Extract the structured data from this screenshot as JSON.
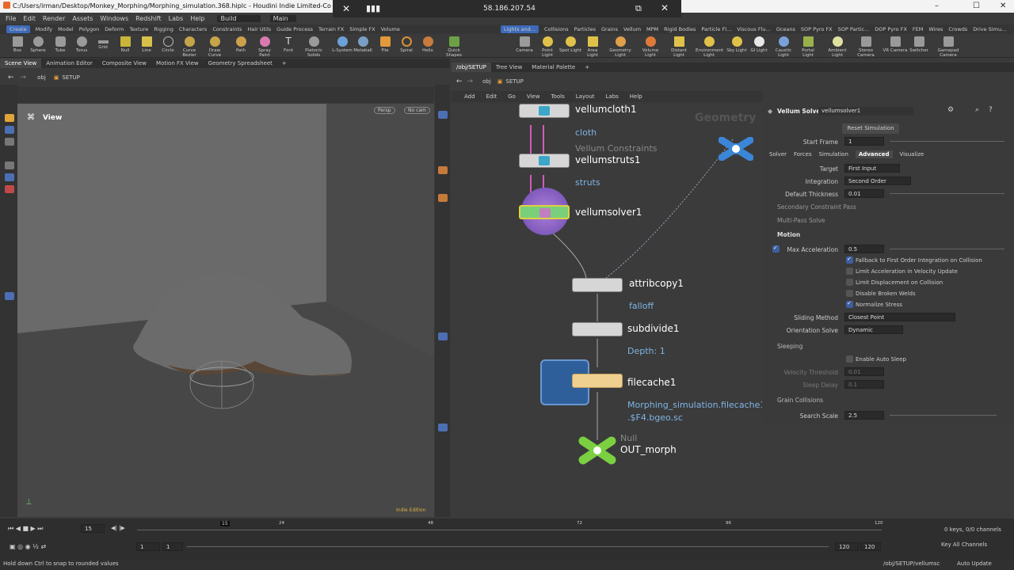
{
  "titlebar": {
    "path": "C:/Users/irman/Desktop/Monkey_Morphing/Morphing_simulation.368.hiplc - Houdini Indie Limited-Commercial 2"
  },
  "remote": {
    "ip": "58.186.207.54"
  },
  "menubar": {
    "items": [
      "File",
      "Edit",
      "Render",
      "Assets",
      "Windows",
      "Redshift",
      "Labs",
      "Help"
    ],
    "desktop": "Build",
    "main": "Main"
  },
  "shelf_tabs_left": [
    "Create",
    "Modify",
    "Model",
    "Polygon",
    "Deform",
    "Texture",
    "Rigging",
    "Characters",
    "Constraints",
    "Hair Utils",
    "Guide Process",
    "Terrain FX",
    "Simple FX",
    "Volume"
  ],
  "shelf_tabs_right": [
    "Lights and...",
    "Collisions",
    "Particles",
    "Grains",
    "Vellum",
    "MPM",
    "Rigid Bodies",
    "Particle Fl...",
    "Viscous Flu...",
    "Oceans",
    "SOP Pyro FX",
    "SOP Partic...",
    "DOP Pyro FX",
    "FEM",
    "Wires",
    "Crowds",
    "Drive Simu..."
  ],
  "tools_left": [
    "Box",
    "Sphere",
    "Tube",
    "Torus",
    "Grid",
    "Null",
    "Line",
    "Circle",
    "Curve Bezier",
    "Draw Curve",
    "Path",
    "Spray Paint",
    "Font",
    "Platonic Solids",
    "L-System",
    "Metaball",
    "File",
    "Spiral",
    "Helix",
    "Quick Shapes"
  ],
  "tools_right": [
    "Camera",
    "Point Light",
    "Spot Light",
    "Area Light",
    "Geometry Light",
    "Volume Light",
    "Distant Light",
    "Environment Light",
    "Sky Light",
    "GI Light",
    "Caustic Light",
    "Portal Light",
    "Ambient Light",
    "Stereo Camera",
    "VR Camera",
    "Switcher",
    "Gamepad Camera"
  ],
  "left_tabs": [
    "Scene View",
    "Animation Editor",
    "Composite View",
    "Motion FX View",
    "Geometry Spreadsheet"
  ],
  "right_tabs": [
    "/obj/SETUP",
    "Tree View",
    "Material Palette"
  ],
  "path": {
    "obj": "obj",
    "setup": "SETUP"
  },
  "viewport": {
    "label": "View",
    "persp": "Persp",
    "cam": "No cam",
    "edition": "Indie Edition"
  },
  "network_menu": [
    "Add",
    "Edit",
    "Go",
    "View",
    "Tools",
    "Layout",
    "Labs",
    "Help"
  ],
  "network": {
    "watermark": "Geometry",
    "nodes": [
      {
        "name": "vellumcloth1",
        "sub": "cloth",
        "type": ""
      },
      {
        "name": "vellumstruts1",
        "sub": "struts",
        "type": "Vellum Constraints"
      },
      {
        "name": "vellumsolver1",
        "sub": "",
        "type": ""
      },
      {
        "name": "attribcopy1",
        "sub": "falloff",
        "type": ""
      },
      {
        "name": "subdivide1",
        "sub": "Depth: 1",
        "type": ""
      },
      {
        "name": "filecache1",
        "sub": "Morphing_simulation.filecache1",
        "sub2": ".$F4.bgeo.sc",
        "type": ""
      },
      {
        "name": "OUT_morph",
        "sub": "",
        "type": "Null"
      }
    ]
  },
  "params": {
    "title": "Vellum Solver",
    "node": "vellumsolver1",
    "reset": "Reset Simulation",
    "start_frame_label": "Start Frame",
    "start_frame": "1",
    "tabs": [
      "Solver",
      "Forces",
      "Simulation",
      "Advanced",
      "Visualize"
    ],
    "target_label": "Target",
    "target": "First Input",
    "integration_label": "Integration",
    "integration": "Second Order",
    "thickness_label": "Default Thickness",
    "thickness": "0.01",
    "secondary": "Secondary Constraint Pass",
    "multipass": "Multi-Pass Solve",
    "motion": "Motion",
    "maxacc_label": "Max Acceleration",
    "maxacc": "0.5",
    "checks": [
      {
        "label": "Fallback to First Order Integration on Collision",
        "on": true
      },
      {
        "label": "Limit Acceleration in Velocity Update",
        "on": false
      },
      {
        "label": "Limit Displacement on Collision",
        "on": false
      },
      {
        "label": "Disable Broken Welds",
        "on": false
      },
      {
        "label": "Normalize Stress",
        "on": true
      }
    ],
    "sliding_label": "Sliding Method",
    "sliding": "Closest Point",
    "orient_label": "Orientation Solve",
    "orient": "Dynamic",
    "sleeping": "Sleeping",
    "autosleep": "Enable Auto Sleep",
    "velthr_label": "Velocity Threshold",
    "velthr": "0.01",
    "sleepdelay_label": "Sleep Delay",
    "sleepdelay": "0.1",
    "grain": "Grain Collisions",
    "searchscale_label": "Search Scale",
    "searchscale": "2.5"
  },
  "timeline": {
    "frame": "15",
    "marks": [
      "24",
      "48",
      "72",
      "96",
      "120"
    ],
    "current": "15",
    "start": "1",
    "start2": "1",
    "end": "120",
    "end2": "120",
    "keys": "0 keys, 0/0 channels",
    "keyall": "Key All Channels"
  },
  "status": {
    "hint": "Hold down Ctrl to snap to rounded values",
    "path": "/obj/SETUP/vellumsc",
    "update": "Auto Update"
  }
}
